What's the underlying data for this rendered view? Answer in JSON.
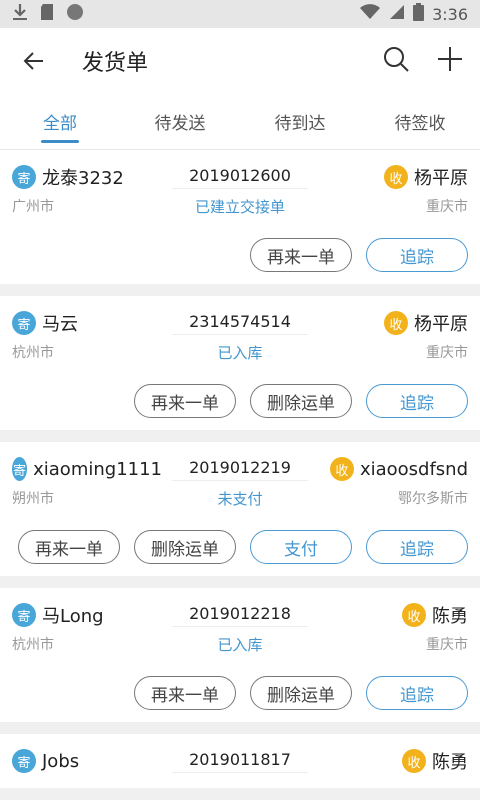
{
  "status_bar": {
    "time": "3:36"
  },
  "header": {
    "title": "发货单"
  },
  "tabs": [
    {
      "label": "全部"
    },
    {
      "label": "待发送"
    },
    {
      "label": "待到达"
    },
    {
      "label": "待签收"
    }
  ],
  "badges": {
    "send": "寄",
    "recv": "收"
  },
  "buttons": {
    "reorder": "再来一单",
    "delete": "删除运单",
    "pay": "支付",
    "track": "追踪"
  },
  "orders": [
    {
      "sender": "龙泰3232",
      "sender_city": "广州市",
      "waybill": "2019012600",
      "status": "已建立交接单",
      "receiver": "杨平原",
      "receiver_city": "重庆市"
    },
    {
      "sender": "马云",
      "sender_city": "杭州市",
      "waybill": "2314574514",
      "status": "已入库",
      "receiver": "杨平原",
      "receiver_city": "重庆市"
    },
    {
      "sender": "xiaoming1111",
      "sender_city": "朔州市",
      "waybill": "2019012219",
      "status": "未支付",
      "receiver": "xiaoosdfsnd",
      "receiver_city": "鄂尔多斯市"
    },
    {
      "sender": "马Long",
      "sender_city": "杭州市",
      "waybill": "2019012218",
      "status": "已入库",
      "receiver": "陈勇",
      "receiver_city": "重庆市"
    },
    {
      "sender": "Jobs",
      "sender_city": "",
      "waybill": "2019011817",
      "status": "",
      "receiver": "陈勇",
      "receiver_city": ""
    }
  ],
  "colors": {
    "accent": "#3c8dc7",
    "send_badge": "#48a6d8",
    "recv_badge": "#f2b21b"
  }
}
